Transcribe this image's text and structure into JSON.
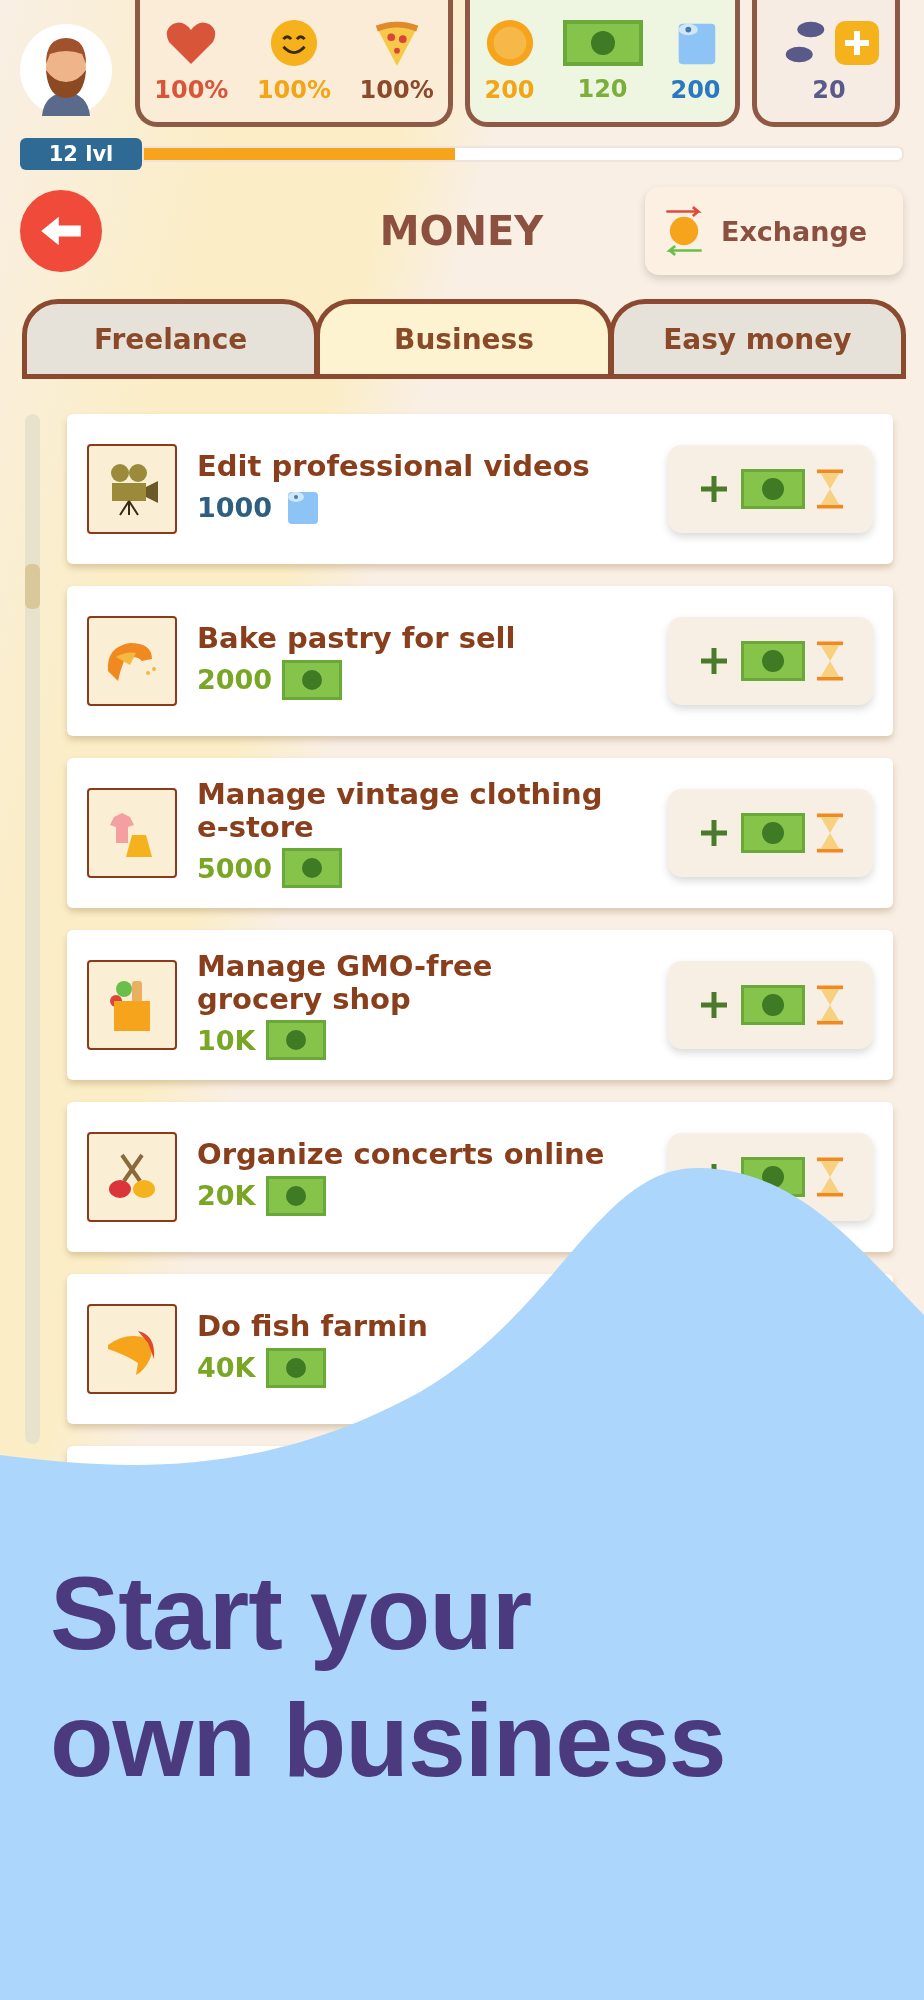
{
  "stats": [
    {
      "items": [
        {
          "kind": "heart",
          "value": "100%",
          "color": "#d9553a"
        },
        {
          "kind": "smile",
          "value": "100%",
          "color": "#f2a516"
        },
        {
          "kind": "pizza",
          "value": "100%",
          "color": "#8b4a2a"
        }
      ]
    },
    {
      "items": [
        {
          "kind": "coin",
          "value": "200",
          "color": "#f2a516"
        },
        {
          "kind": "cash",
          "value": "120",
          "color": "#7ab03a"
        },
        {
          "kind": "paper",
          "value": "200",
          "color": "#2a78c0"
        }
      ]
    },
    {
      "items": [
        {
          "kind": "steps",
          "value": "20",
          "color": "#5a5a8a"
        }
      ]
    }
  ],
  "level": {
    "label": "12 lvl",
    "level": 0.41
  },
  "header": {
    "title": "MONEY",
    "exchange_label": "Exchange"
  },
  "tabs": [
    {
      "label": "Freelance",
      "selected": false
    },
    {
      "label": "Business",
      "selected": true
    },
    {
      "label": "Easy money",
      "selected": false
    }
  ],
  "jobs": [
    {
      "kind": "paper",
      "title": "Edit professional videos",
      "price": "1000",
      "button_visible": true
    },
    {
      "kind": "cash",
      "title": "Bake pastry for sell",
      "price": "2000",
      "button_visible": true
    },
    {
      "kind": "cash",
      "title": "Manage vintage clothing\ne-store",
      "price": "5000",
      "button_visible": true
    },
    {
      "kind": "cash",
      "title": "Manage GMO-free\ngrocery shop",
      "price": "10K",
      "button_visible": true
    },
    {
      "kind": "cash",
      "title": "Organize concerts online",
      "price": "20K",
      "button_visible": true
    },
    {
      "kind": "cash",
      "title": "Do fish farmin",
      "price": "40K"
    }
  ],
  "headline": "Start your\nown business"
}
